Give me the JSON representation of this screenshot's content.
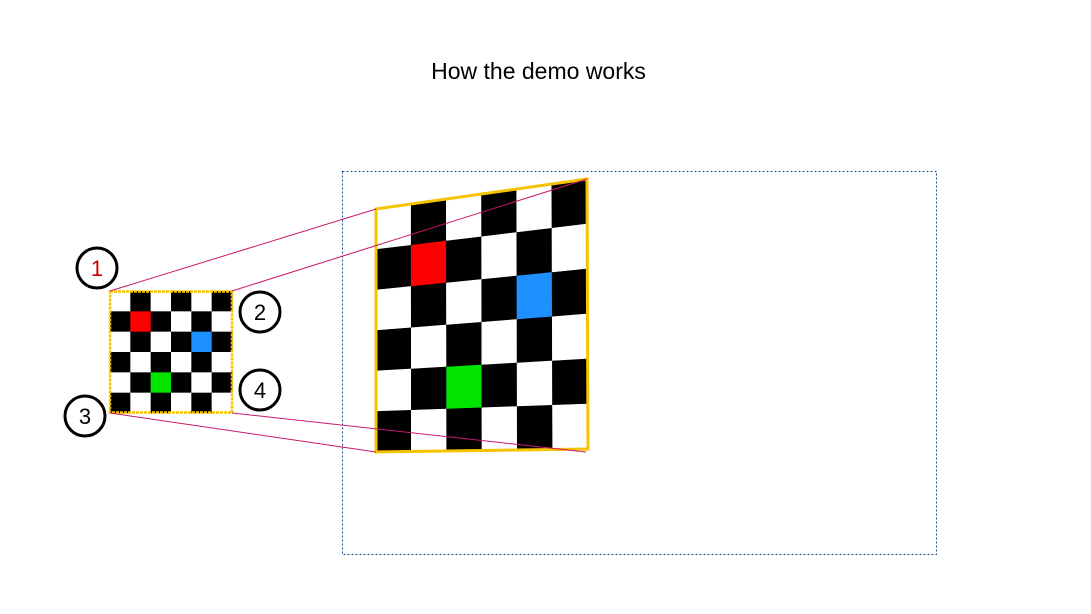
{
  "slide": {
    "title": "How the demo works"
  },
  "source_board": {
    "rows": 6,
    "cols": 6,
    "border_color": "#f5c400",
    "dark_color": "#000000",
    "light_color": "#ffffff",
    "highlights": [
      {
        "name": "red",
        "row": 1,
        "col": 1,
        "color": "#ff0000"
      },
      {
        "name": "blue",
        "row": 2,
        "col": 4,
        "color": "#1e90ff"
      },
      {
        "name": "green",
        "row": 4,
        "col": 2,
        "color": "#00e400"
      }
    ]
  },
  "corners": [
    {
      "id": "corner-1",
      "label": "1",
      "label_color": "#cc0000"
    },
    {
      "id": "corner-2",
      "label": "2",
      "label_color": "#000000"
    },
    {
      "id": "corner-3",
      "label": "3",
      "label_color": "#000000"
    },
    {
      "id": "corner-4",
      "label": "4",
      "label_color": "#000000"
    }
  ],
  "connector_color": "#c8186e",
  "target_frame_color": "#1f4e8c"
}
